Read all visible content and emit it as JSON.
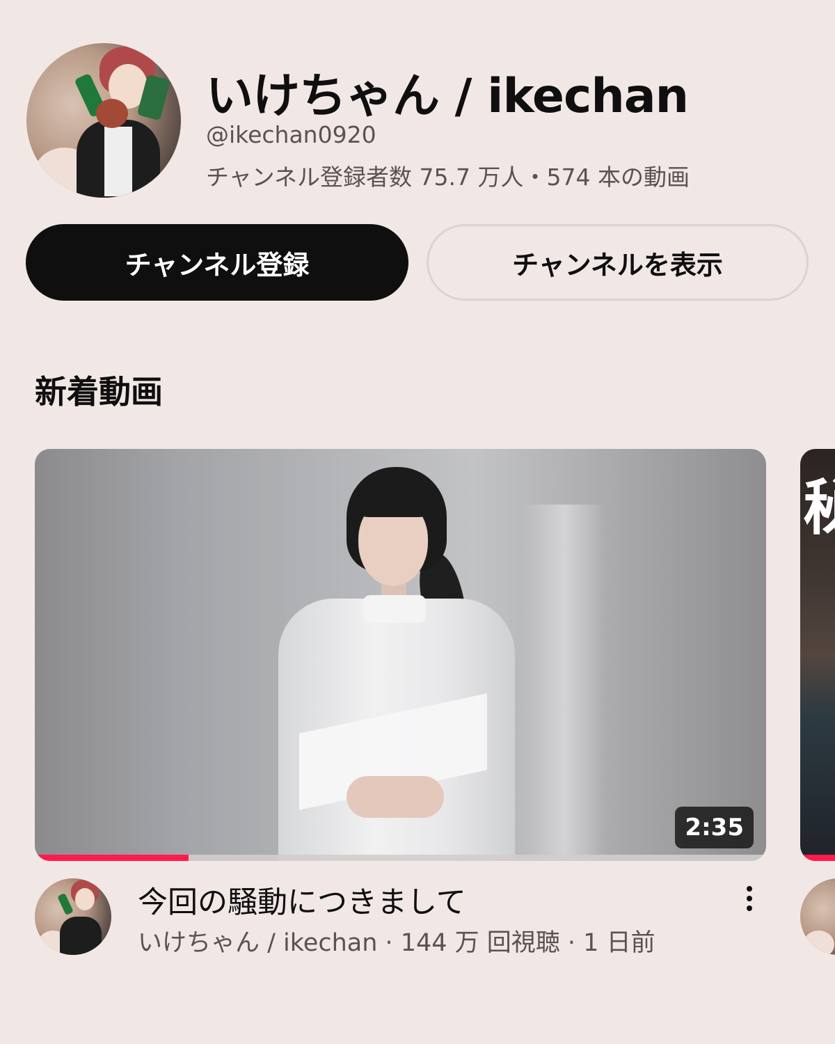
{
  "channel": {
    "name": "いけちゃん / ikechan",
    "handle": "@ikechan0920",
    "stats": "チャンネル登録者数 75.7 万人・574 本の動画"
  },
  "actions": {
    "subscribe_label": "チャンネル登録",
    "view_channel_label": "チャンネルを表示"
  },
  "section": {
    "title": "新着動画"
  },
  "video": {
    "title": "今回の騒動につきまして",
    "meta": "いけちゃん / ikechan · 144 万 回視聴 · 1 日前",
    "duration": "2:35",
    "watch_progress": 0.21
  },
  "next_video": {
    "thumbnail_text": "秘"
  },
  "colors": {
    "background": "#f1e8e6",
    "primary_button": "#0f0f0f",
    "progress": "#ff1a4b"
  },
  "icons": {
    "more": "more-vertical-icon"
  }
}
